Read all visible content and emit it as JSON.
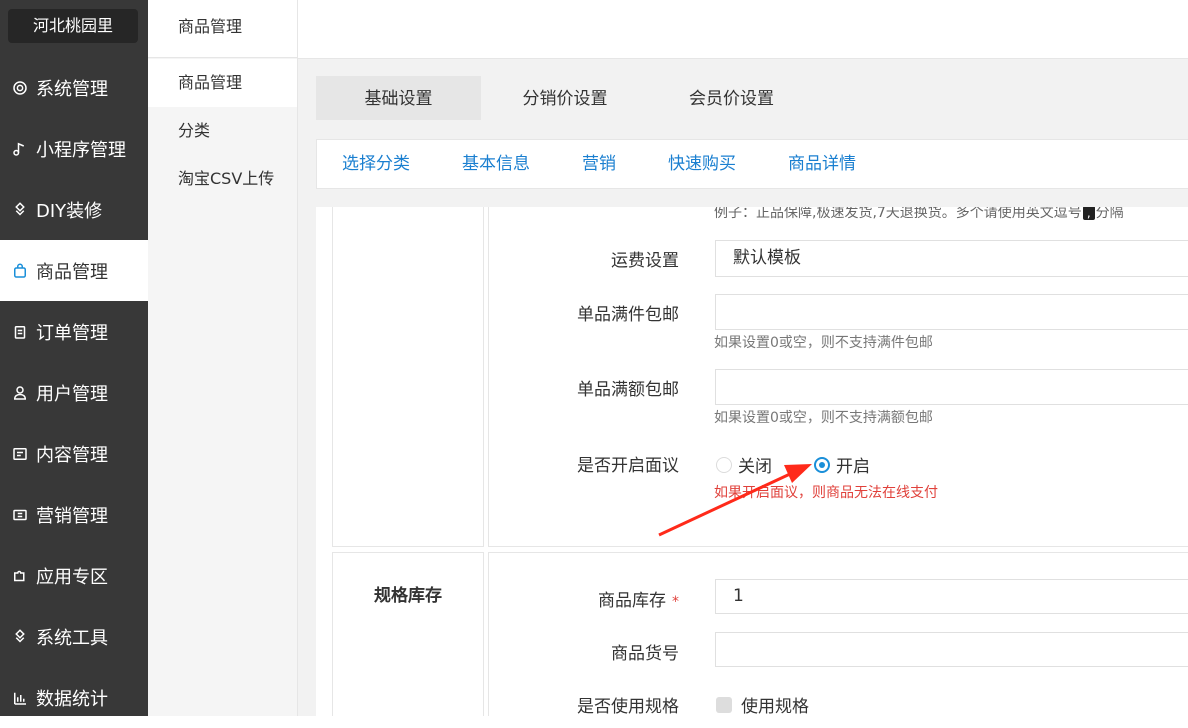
{
  "brand": "河北桃园里",
  "nav": [
    {
      "label": "系统管理",
      "icon": "gear-icon"
    },
    {
      "label": "小程序管理",
      "icon": "music-note-icon"
    },
    {
      "label": "DIY装修",
      "icon": "diamond-grid-icon"
    },
    {
      "label": "商品管理",
      "icon": "bag-icon",
      "active": true
    },
    {
      "label": "订单管理",
      "icon": "clipboard-icon"
    },
    {
      "label": "用户管理",
      "icon": "user-icon"
    },
    {
      "label": "内容管理",
      "icon": "document-icon"
    },
    {
      "label": "营销管理",
      "icon": "ticket-icon"
    },
    {
      "label": "应用专区",
      "icon": "puzzle-icon"
    },
    {
      "label": "系统工具",
      "icon": "tools-icon"
    },
    {
      "label": "数据统计",
      "icon": "bar-chart-icon"
    }
  ],
  "subnav": {
    "title": "商品管理",
    "items": [
      "商品管理",
      "分类",
      "淘宝CSV上传"
    ]
  },
  "tabs_primary": [
    "基础设置",
    "分销价设置",
    "会员价设置"
  ],
  "tabs_secondary": [
    "选择分类",
    "基本信息",
    "营销",
    "快速购买",
    "商品详情"
  ],
  "form": {
    "top_hint": "例子：正品保障,极速发货,7天退换货。多个请使用英文逗号",
    "top_hint_comma": ",",
    "top_hint_tail": "分隔",
    "shipping_label": "运费设置",
    "shipping_value": "默认模板",
    "free_pieces_label": "单品满件包邮",
    "free_pieces_value": "",
    "free_pieces_hint": "如果设置0或空，则不支持满件包邮",
    "free_amount_label": "单品满额包邮",
    "free_amount_value": "",
    "free_amount_hint": "如果设置0或空，则不支持满额包邮",
    "negotiate_label": "是否开启面议",
    "negotiate_off": "关闭",
    "negotiate_on": "开启",
    "negotiate_selected": "开启",
    "negotiate_hint": "如果开启面议，则商品无法在线支付",
    "spec_section_title": "规格库存",
    "stock_label": "商品库存",
    "stock_required": "*",
    "stock_value": "1",
    "sku_label": "商品货号",
    "sku_value": "",
    "use_spec_label": "是否使用规格",
    "use_spec_checkbox": "使用规格"
  },
  "colors": {
    "sidebar": "#383838",
    "accent": "#1a8fd9",
    "link": "#1a7fd0",
    "warn": "#e0413b",
    "annotation_arrow": "#ff2a1a"
  }
}
